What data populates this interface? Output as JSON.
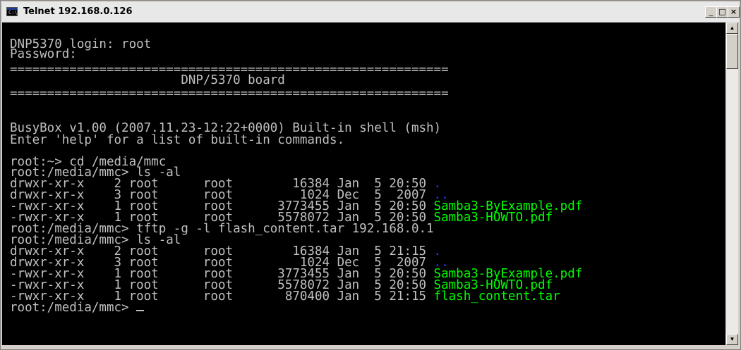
{
  "window": {
    "title": "Telnet 192.168.0.126",
    "icon_text": "C:\\",
    "controls": {
      "minimize": "_",
      "maximize": "□",
      "close": "×"
    }
  },
  "terminal": {
    "lines": [
      {
        "text": "DNP5370 login: root"
      },
      {
        "text": "Password:"
      },
      {
        "text": "==========================================================="
      },
      {
        "text": "                       DNP/5370 board"
      },
      {
        "text": "==========================================================="
      },
      {
        "text": "BusyBox v1.00 (2007.11.23-12:22+0000) Built-in shell (msh)"
      },
      {
        "text": "Enter 'help' for a list of built-in commands."
      },
      {
        "text": "root:~> cd /media/mmc"
      },
      {
        "text": "root:/media/mmc> ls -al"
      },
      {
        "text": "drwxr-xr-x    2 root      root        16384 Jan  5 20:50 ",
        "file": ".",
        "file_color": "blue"
      },
      {
        "text": "drwxr-xr-x    3 root      root         1024 Dec  5  2007 ",
        "file": "..",
        "file_color": "blue"
      },
      {
        "text": "-rwxr-xr-x    1 root      root      3773455 Jan  5 20:50 ",
        "file": "Samba3-ByExample.pdf",
        "file_color": "green"
      },
      {
        "text": "-rwxr-xr-x    1 root      root      5578072 Jan  5 20:50 ",
        "file": "Samba3-HOWTO.pdf",
        "file_color": "green"
      },
      {
        "text": "root:/media/mmc> tftp -g -l flash_content.tar 192.168.0.1"
      },
      {
        "text": "root:/media/mmc> ls -al"
      },
      {
        "text": "drwxr-xr-x    2 root      root        16384 Jan  5 21:15 ",
        "file": ".",
        "file_color": "blue"
      },
      {
        "text": "drwxr-xr-x    3 root      root         1024 Dec  5  2007 ",
        "file": "..",
        "file_color": "blue"
      },
      {
        "text": "-rwxr-xr-x    1 root      root      3773455 Jan  5 20:50 ",
        "file": "Samba3-ByExample.pdf",
        "file_color": "green"
      },
      {
        "text": "-rwxr-xr-x    1 root      root      5578072 Jan  5 20:50 ",
        "file": "Samba3-HOWTO.pdf",
        "file_color": "green"
      },
      {
        "text": "-rwxr-xr-x    1 root      root       870400 Jan  5 21:15 ",
        "file": "flash_content.tar",
        "file_color": "green"
      },
      {
        "text": "root:/media/mmc> ",
        "cursor": true
      }
    ]
  },
  "scrollbar": {
    "up": "▲",
    "down": "▼"
  }
}
